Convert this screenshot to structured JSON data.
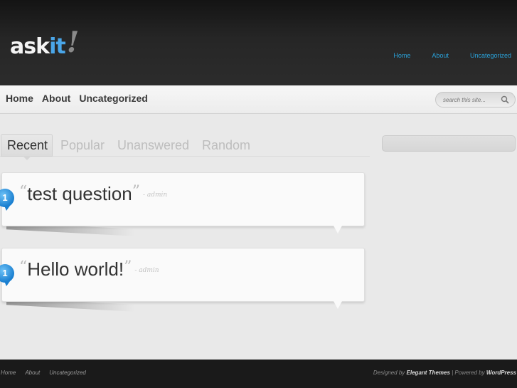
{
  "header": {
    "logo": {
      "part1": "ask",
      "part2": "it",
      "part3": "!"
    },
    "top_nav": [
      "Home",
      "About",
      "Uncategorized"
    ]
  },
  "main_nav": [
    "Home",
    "About",
    "Uncategorized"
  ],
  "search": {
    "placeholder": "search this site..."
  },
  "tabs": [
    "Recent",
    "Popular",
    "Unanswered",
    "Random"
  ],
  "active_tab": "Recent",
  "questions": [
    {
      "title": "test question",
      "author": "- admin",
      "answers": "1"
    },
    {
      "title": "Hello world!",
      "author": "- admin",
      "answers": "1"
    }
  ],
  "quote_open": "“",
  "quote_close": "”",
  "footer": {
    "nav": [
      "Home",
      "About",
      "Uncategorized"
    ],
    "credits": {
      "designed_by": "Designed by",
      "elegant": "Elegant Themes",
      "sep": " | Powered by ",
      "wordpress": "WordPress"
    }
  },
  "colors": {
    "accent": "#2aa1d8",
    "header_bg": "#262626",
    "bubble": "#1a7fd0"
  }
}
